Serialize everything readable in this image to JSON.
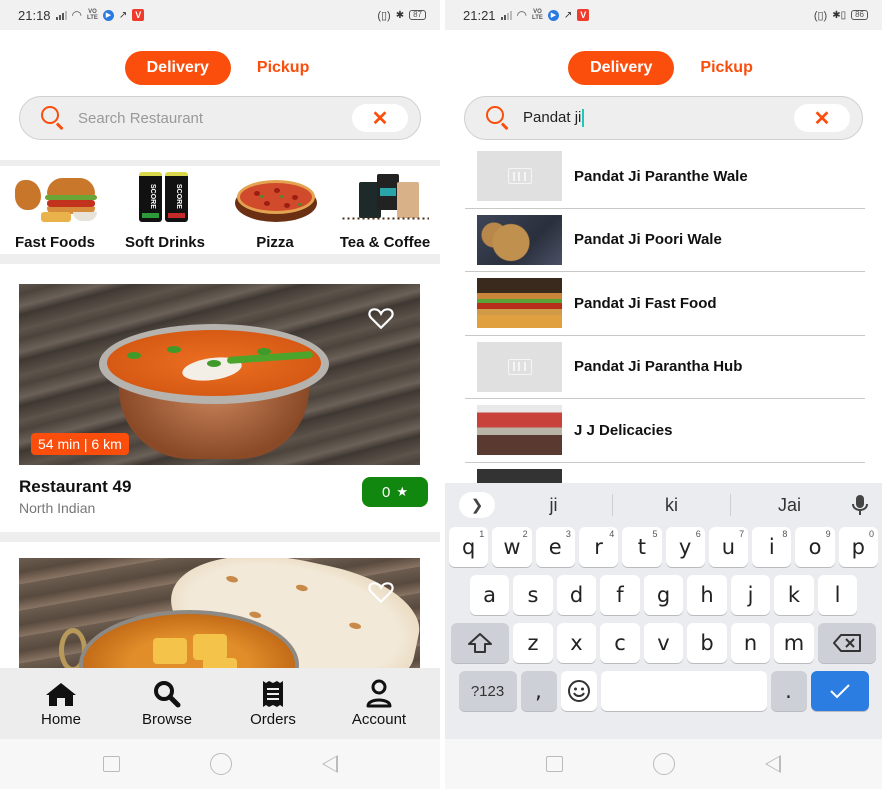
{
  "left_screen": {
    "status_bar": {
      "time": "21:18",
      "network": "VoLTE",
      "battery": "87"
    },
    "mode_toggle": {
      "active": "Delivery",
      "inactive": "Pickup"
    },
    "search": {
      "placeholder": "Search Restaurant",
      "value": "",
      "clear_icon": "close-icon"
    },
    "categories": [
      {
        "label": "Fast Foods",
        "icon": "burger-image"
      },
      {
        "label": "Soft Drinks",
        "icon": "cans-image"
      },
      {
        "label": "Pizza",
        "icon": "pizza-image"
      },
      {
        "label": "Tea & Coffee",
        "icon": "coffee-bags-image"
      }
    ],
    "restaurants": [
      {
        "name": "Restaurant 49",
        "cuisine": "North Indian",
        "eta": "54 min | 6 km",
        "rating": "0",
        "favorite": false
      },
      {
        "name": "",
        "cuisine": "",
        "favorite": false
      }
    ],
    "bottom_nav": [
      {
        "label": "Home",
        "icon": "home-icon"
      },
      {
        "label": "Browse",
        "icon": "search-icon"
      },
      {
        "label": "Orders",
        "icon": "receipt-icon"
      },
      {
        "label": "Account",
        "icon": "user-icon"
      }
    ]
  },
  "right_screen": {
    "status_bar": {
      "time": "21:21",
      "network": "VoLTE",
      "battery": "86"
    },
    "mode_toggle": {
      "active": "Delivery",
      "inactive": "Pickup"
    },
    "search": {
      "placeholder": "Search Restaurant",
      "value": "Pandat ji",
      "clear_icon": "close-icon"
    },
    "results": [
      {
        "name": "Pandat Ji Paranthe Wale",
        "thumb": "placeholder"
      },
      {
        "name": "Pandat Ji Poori Wale",
        "thumb": "poori-photo"
      },
      {
        "name": "Pandat Ji Fast Food",
        "thumb": "burger-photo"
      },
      {
        "name": "Pandat Ji Parantha Hub",
        "thumb": "placeholder"
      },
      {
        "name": "J J Delicacies",
        "thumb": "storefront-photo"
      }
    ],
    "keyboard": {
      "suggestions": [
        "ji",
        "ki",
        "Jai"
      ],
      "row1": [
        {
          "k": "q",
          "n": "1"
        },
        {
          "k": "w",
          "n": "2"
        },
        {
          "k": "e",
          "n": "3"
        },
        {
          "k": "r",
          "n": "4"
        },
        {
          "k": "t",
          "n": "5"
        },
        {
          "k": "y",
          "n": "6"
        },
        {
          "k": "u",
          "n": "7"
        },
        {
          "k": "i",
          "n": "8"
        },
        {
          "k": "o",
          "n": "9"
        },
        {
          "k": "p",
          "n": "0"
        }
      ],
      "row2": [
        "a",
        "s",
        "d",
        "f",
        "g",
        "h",
        "j",
        "k",
        "l"
      ],
      "row3": [
        "z",
        "x",
        "c",
        "v",
        "b",
        "n",
        "m"
      ],
      "symbols_label": "?123",
      "comma": ",",
      "period": ".",
      "space_label": ""
    }
  },
  "colors": {
    "accent": "#fb4d0c",
    "rating_green": "#12870f",
    "enter_blue": "#2b7de2",
    "caret": "#1ec8b8"
  }
}
